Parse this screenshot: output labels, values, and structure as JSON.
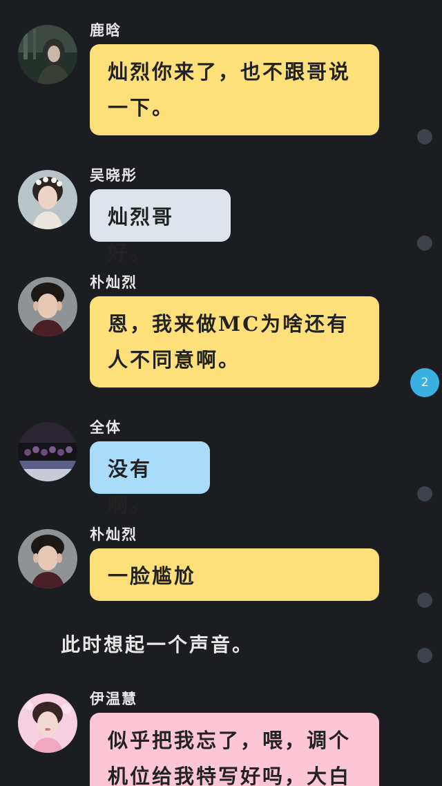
{
  "messages": [
    {
      "sender": "鹿晗",
      "text": "灿烈你来了，也不跟哥说一下。",
      "bubble_color": "#fde07a",
      "avatar": "luhan-avatar"
    },
    {
      "sender": "吴晓彤",
      "text": "灿烈哥好。",
      "bubble_color": "#dde4ec",
      "avatar": "wuxiaotong-avatar"
    },
    {
      "sender": "朴灿烈",
      "text": "恩，我来做MC为啥还有人不同意啊。",
      "bubble_color": "#fde07a",
      "avatar": "park-chanyeol-avatar"
    },
    {
      "sender": "全体",
      "text": "没有啊。",
      "bubble_color": "#a9dcf8",
      "avatar": "group-avatar"
    },
    {
      "sender": "朴灿烈",
      "text": "一脸尴尬",
      "bubble_color": "#fde07a",
      "avatar": "park-chanyeol-avatar"
    },
    {
      "sender": "伊温慧",
      "text": "似乎把我忘了，喂，调个机位给我特写好吗，大白牙你",
      "bubble_color": "#fcc6d6",
      "avatar": "yiwenhui-avatar"
    }
  ],
  "narration": "此时想起一个声音。",
  "badge_count": "2",
  "colors": {
    "background": "#1c1d21",
    "badge": "#3ab0e2",
    "dot": "#3c434b"
  }
}
